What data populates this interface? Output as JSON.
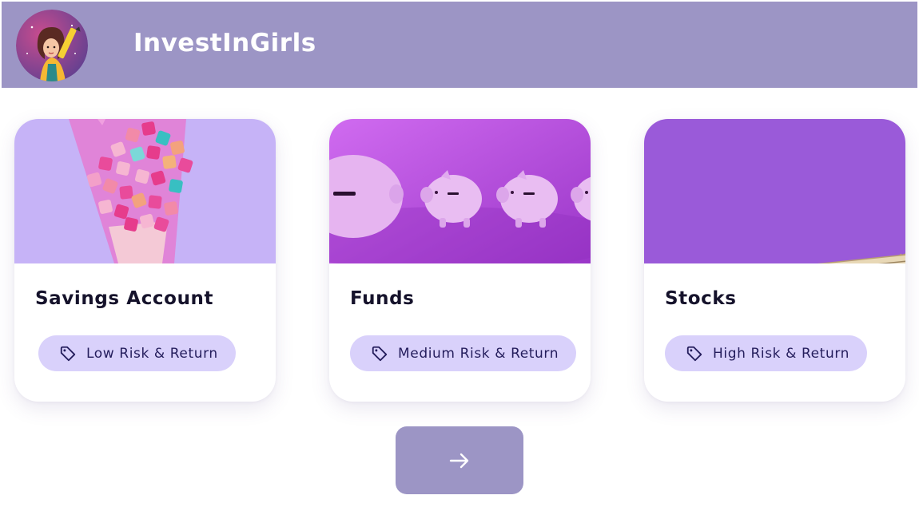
{
  "header": {
    "app_title": "InvestInGirls",
    "logo_icon": "girl-with-pencil-avatar"
  },
  "cards": [
    {
      "title": "Savings Account",
      "risk_label": "Low Risk & Return",
      "image": "dice-cone-photo",
      "tag_icon": "tag-icon"
    },
    {
      "title": "Funds",
      "risk_label": "Medium Risk & Return",
      "image": "piggy-banks-photo",
      "tag_icon": "tag-icon"
    },
    {
      "title": "Stocks",
      "risk_label": "High Risk & Return",
      "image": "dollar-bills-fan-photo",
      "tag_icon": "tag-icon"
    }
  ],
  "next_button": {
    "icon": "arrow-right-icon"
  },
  "colors": {
    "header_bg": "#9c95c5",
    "chip_bg": "#d9d1fb",
    "chip_text": "#241d5c",
    "title_text": "#15122b"
  }
}
